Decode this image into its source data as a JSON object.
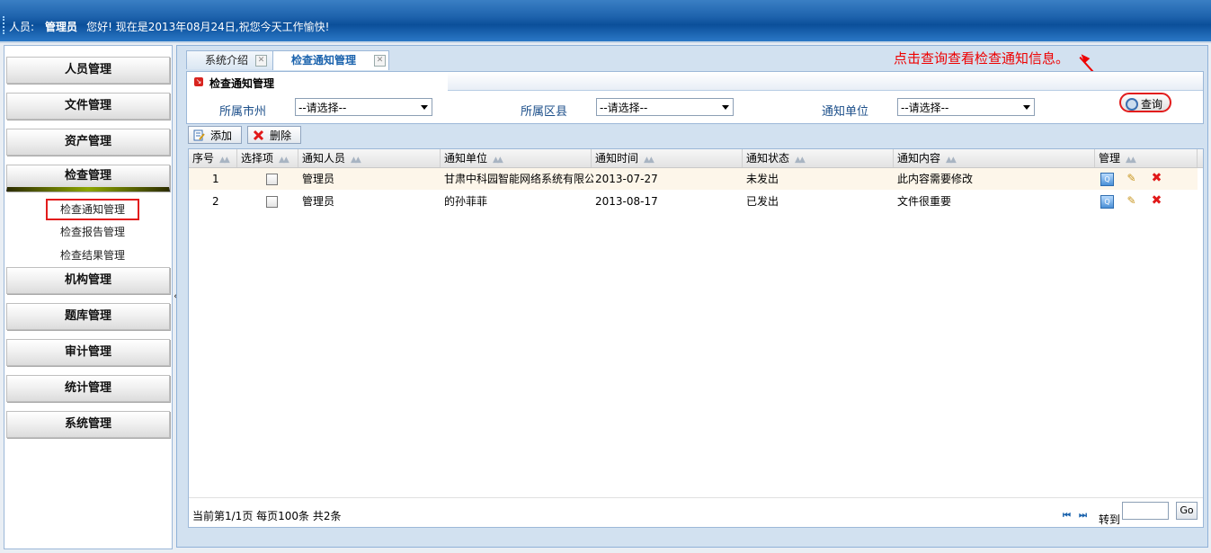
{
  "header": {
    "user_label": "人员:",
    "user_name": "管理员",
    "greeting": "您好!  现在是2013年08月24日,祝您今天工作愉快!"
  },
  "sidebar": {
    "items": [
      {
        "label": "人员管理"
      },
      {
        "label": "文件管理"
      },
      {
        "label": "资产管理"
      },
      {
        "label": "检查管理"
      },
      {
        "label": "机构管理"
      },
      {
        "label": "题库管理"
      },
      {
        "label": "审计管理"
      },
      {
        "label": "统计管理"
      },
      {
        "label": "系统管理"
      }
    ],
    "subitems": [
      {
        "label": "检查通知管理"
      },
      {
        "label": "检查报告管理"
      },
      {
        "label": "检查结果管理"
      }
    ],
    "collapse_glyph": "«"
  },
  "tabs": [
    {
      "label": "系统介绍"
    },
    {
      "label": "检查通知管理"
    }
  ],
  "annotation": "点击查询查看检查通知信息。",
  "panel": {
    "title": "检查通知管理",
    "filters": [
      {
        "label": "所属市州",
        "value": "--请选择--"
      },
      {
        "label": "所属区县",
        "value": "--请选择--"
      },
      {
        "label": "通知单位",
        "value": "--请选择--"
      }
    ],
    "query_label": "查询"
  },
  "toolbar": {
    "add_label": "添加",
    "delete_label": "删除"
  },
  "table": {
    "headers": [
      "序号",
      "选择项",
      "通知人员",
      "通知单位",
      "通知时间",
      "通知状态",
      "通知内容",
      "管理"
    ],
    "rows": [
      {
        "no": "1",
        "person": "管理员",
        "unit": "甘肃中科园智能网络系统有限公",
        "time": "2013-07-27",
        "status": "未发出",
        "content": "此内容需要修改"
      },
      {
        "no": "2",
        "person": "管理员",
        "unit": "的孙菲菲",
        "time": "2013-08-17",
        "status": "已发出",
        "content": "文件很重要"
      }
    ]
  },
  "pager": {
    "info": "当前第1/1页  每页100条  共2条",
    "goto_label": "转到",
    "go_label": "Go"
  }
}
